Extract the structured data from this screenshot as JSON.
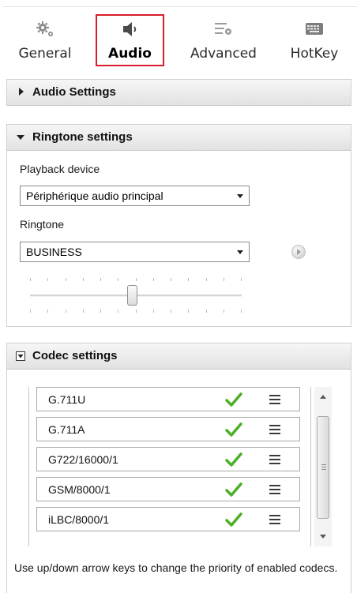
{
  "tabs": [
    {
      "label": "General",
      "icon": "gears-icon",
      "active": false
    },
    {
      "label": "Audio",
      "icon": "speaker-icon",
      "active": true
    },
    {
      "label": "Advanced",
      "icon": "list-settings-icon",
      "active": false
    },
    {
      "label": "HotKey",
      "icon": "keyboard-icon",
      "active": false
    }
  ],
  "audio_settings": {
    "title": "Audio Settings",
    "expanded": false
  },
  "ringtone_settings": {
    "title": "Ringtone settings",
    "expanded": true,
    "playback_label": "Playback device",
    "playback_value": "Périphérique audio principal",
    "ringtone_label": "Ringtone",
    "ringtone_value": "BUSINESS",
    "volume_level": 0.48
  },
  "codec_settings": {
    "title": "Codec settings",
    "codecs": [
      {
        "name": "G.711U",
        "enabled": true
      },
      {
        "name": "G.711A",
        "enabled": true
      },
      {
        "name": "G722/16000/1",
        "enabled": true
      },
      {
        "name": "GSM/8000/1",
        "enabled": true
      },
      {
        "name": "iLBC/8000/1",
        "enabled": true
      }
    ],
    "hint": "Use up/down arrow keys to change the priority of enabled codecs."
  },
  "colors": {
    "active_tab_border": "#d81e2b",
    "check": "#4caf28"
  }
}
